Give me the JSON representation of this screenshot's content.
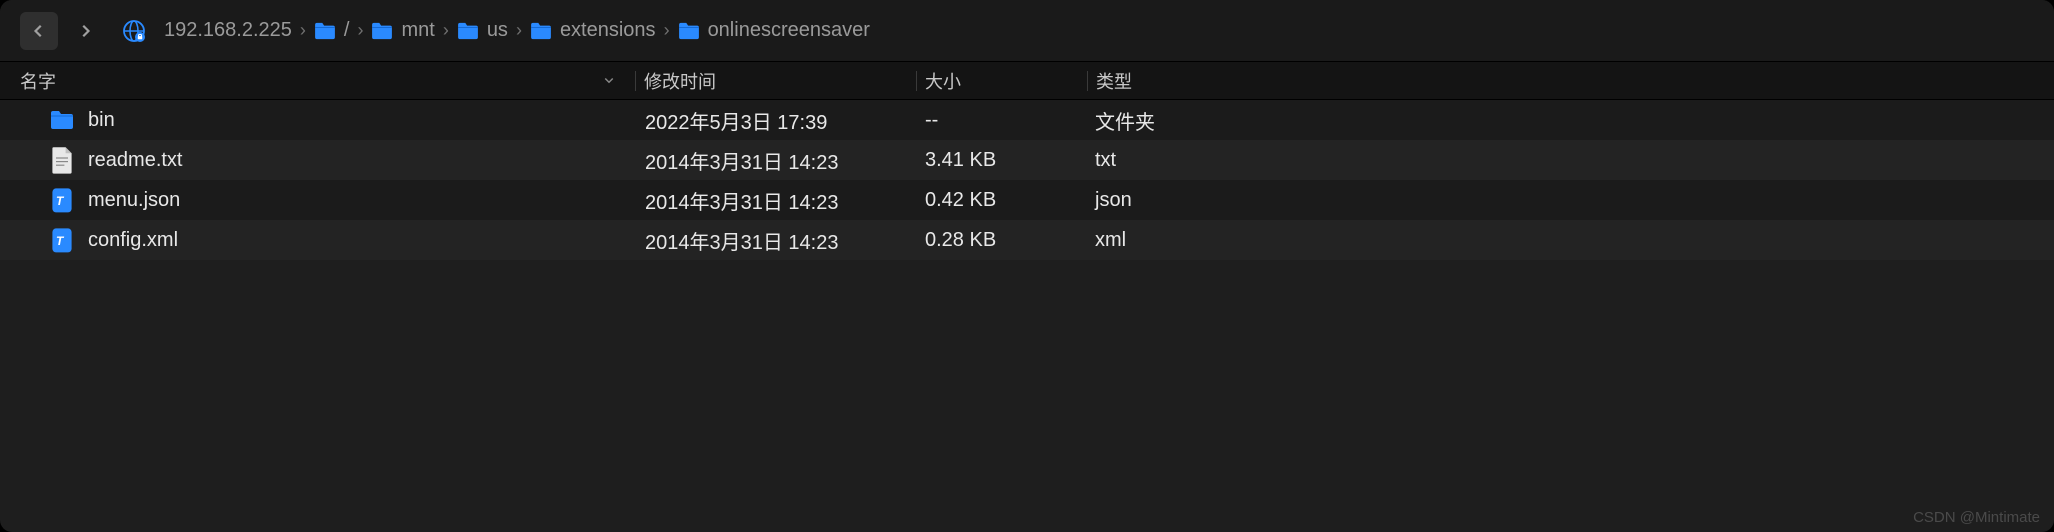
{
  "breadcrumb": {
    "host": "192.168.2.225",
    "segments": [
      {
        "label": "/"
      },
      {
        "label": "mnt"
      },
      {
        "label": "us"
      },
      {
        "label": "extensions"
      },
      {
        "label": "onlinescreensaver"
      }
    ]
  },
  "columns": {
    "name": "名字",
    "date": "修改时间",
    "size": "大小",
    "type": "类型"
  },
  "rows": [
    {
      "icon": "folder",
      "name": "bin",
      "date": "2022年5月3日 17:39",
      "size": "--",
      "type": "文件夹"
    },
    {
      "icon": "txt",
      "name": "readme.txt",
      "date": "2014年3月31日 14:23",
      "size": "3.41 KB",
      "type": "txt"
    },
    {
      "icon": "code",
      "name": "menu.json",
      "date": "2014年3月31日 14:23",
      "size": "0.42 KB",
      "type": "json"
    },
    {
      "icon": "code",
      "name": "config.xml",
      "date": "2014年3月31日 14:23",
      "size": "0.28 KB",
      "type": "xml"
    }
  ],
  "watermark": "CSDN @Mintimate"
}
